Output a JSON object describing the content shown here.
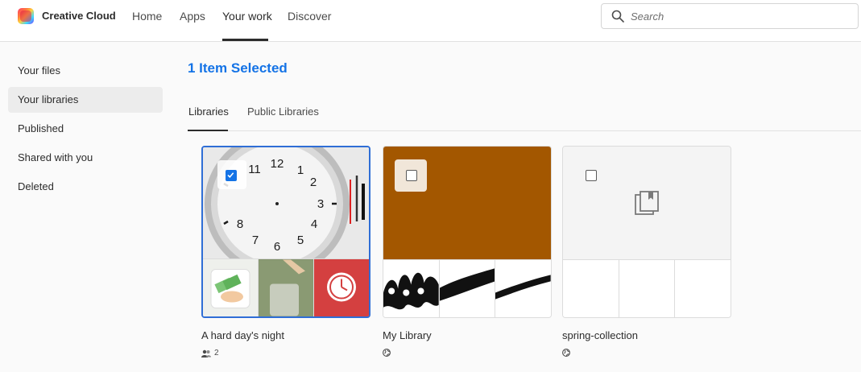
{
  "header": {
    "brand": "Creative Cloud",
    "nav": [
      {
        "label": "Home"
      },
      {
        "label": "Apps"
      },
      {
        "label": "Your work"
      },
      {
        "label": "Discover"
      }
    ],
    "active_nav": "Your work",
    "search_placeholder": "Search"
  },
  "sidebar": {
    "items": [
      {
        "label": "Your files"
      },
      {
        "label": "Your libraries"
      },
      {
        "label": "Published"
      },
      {
        "label": "Shared with you"
      },
      {
        "label": "Deleted"
      }
    ],
    "active": "Your libraries"
  },
  "main": {
    "selection_title": "1 Item Selected",
    "tabs": [
      {
        "label": "Libraries"
      },
      {
        "label": "Public Libraries"
      }
    ],
    "active_tab": "Libraries",
    "libraries": [
      {
        "name": "A hard day's night",
        "selected": true,
        "meta_icon": "people-icon",
        "meta_count": "2",
        "hero": "clock-image",
        "thumbs": [
          "money-hand-image",
          "coin-jar-image",
          "red-clock-icon-image"
        ]
      },
      {
        "name": "My Library",
        "selected": false,
        "meta_icon": "globe-icon",
        "hero_color": "#a35700",
        "thumbs": [
          "ink-splatter-brush",
          "black-brush-stroke",
          "thin-brush-stroke"
        ]
      },
      {
        "name": "spring-collection",
        "selected": false,
        "meta_icon": "globe-icon",
        "hero": "library-icon",
        "thumbs": [
          "empty",
          "empty",
          "empty"
        ]
      }
    ]
  },
  "colors": {
    "accent": "#1473e6",
    "selected_border": "#2f6ed6",
    "my_library_hero": "#a35700"
  }
}
